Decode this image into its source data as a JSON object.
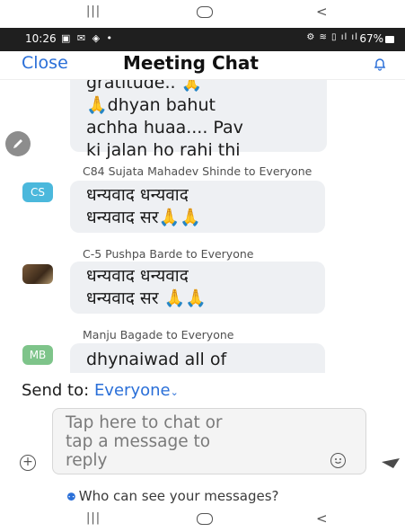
{
  "colors": {
    "accent": "#2a6fd8",
    "status_bar": "#1f1f1f",
    "bubble": "#eef0f3"
  },
  "status": {
    "time": "10:26",
    "battery": "67%",
    "left_icons": "▣ ✉ ◈ •",
    "right_icons": "⚙ ≋ ▯ ıl ıl"
  },
  "header": {
    "close_label": "Close",
    "title": "Meeting Chat",
    "bell_icon": "bell-icon"
  },
  "messages": [
    {
      "sender": "",
      "avatar": "",
      "text_lines": [
        "gratitude.. 🙏",
        "🙏dhyan bahut",
        "achha huaa.... Pav",
        "ki jalan ho rahi thi"
      ]
    },
    {
      "sender": "C84 Sujata Mahadev Shinde to Everyone",
      "avatar": "CS",
      "avatar_color": "#4bb8dc",
      "text_lines": [
        "धन्यवाद धन्यवाद",
        "धन्यवाद सर🙏🙏"
      ]
    },
    {
      "sender": "C-5 Pushpa Barde to Everyone",
      "avatar": "photo",
      "text_lines": [
        "धन्यवाद धन्यवाद",
        "धन्यवाद सर 🙏🙏"
      ]
    },
    {
      "sender": "Manju Bagade to Everyone",
      "avatar": "MB",
      "avatar_color": "#7ec48a",
      "text_lines": [
        "dhynaiwad all of"
      ]
    }
  ],
  "compose": {
    "send_to_label": "Send to:",
    "send_to_target": "Everyone",
    "placeholder_lines": [
      "Tap here to chat or",
      "tap a message to",
      "reply"
    ]
  },
  "footer": {
    "who_can_see": "Who can see your messages?"
  }
}
